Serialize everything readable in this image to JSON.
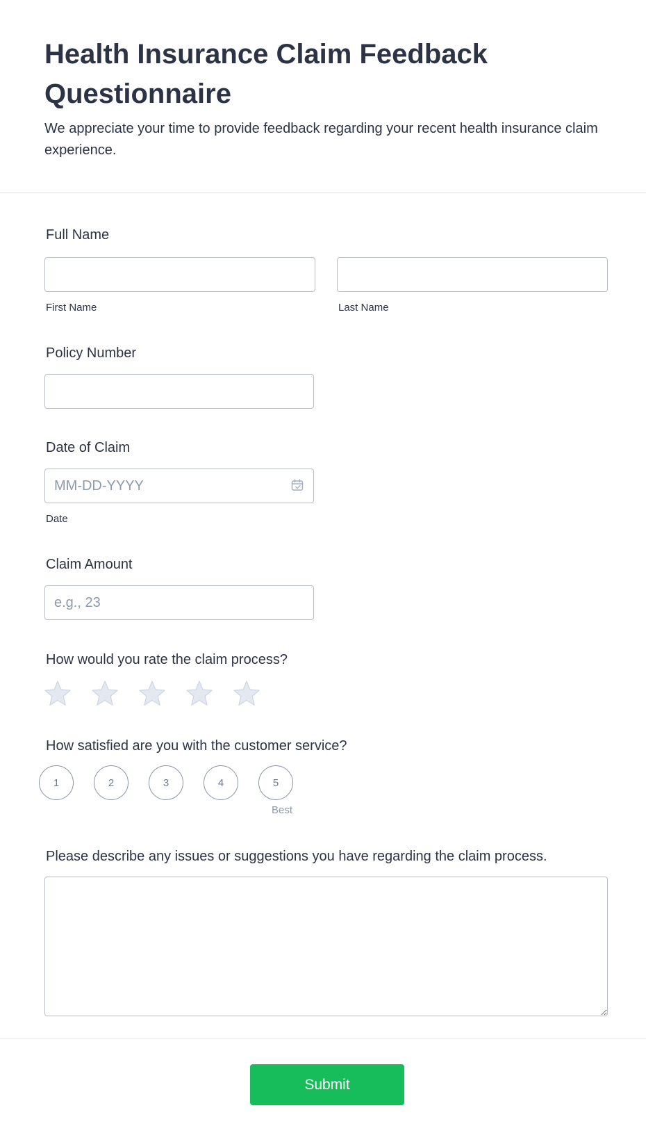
{
  "header": {
    "title": "Health Insurance Claim Feedback Questionnaire",
    "subtitle": "We appreciate your time to provide feedback regarding your recent health insurance claim experience."
  },
  "full_name": {
    "label": "Full Name",
    "first": {
      "sublabel": "First Name",
      "value": ""
    },
    "last": {
      "sublabel": "Last Name",
      "value": ""
    }
  },
  "policy_number": {
    "label": "Policy Number",
    "value": ""
  },
  "date_of_claim": {
    "label": "Date of Claim",
    "placeholder": "MM-DD-YYYY",
    "sublabel": "Date",
    "icon": "calendar-icon"
  },
  "claim_amount": {
    "label": "Claim Amount",
    "placeholder": "e.g., 23"
  },
  "rating": {
    "label": "How would you rate the claim process?",
    "max": 5,
    "value": 0,
    "icon": "star-icon",
    "empty_color": "#e3e8f1",
    "stroke_color": "#cfd5e1"
  },
  "satisfaction": {
    "label": "How satisfied are you with the customer service?",
    "options": [
      "1",
      "2",
      "3",
      "4",
      "5"
    ],
    "best_label": "Best"
  },
  "issues": {
    "label": "Please describe any issues or suggestions you have regarding the claim process.",
    "value": ""
  },
  "submit": {
    "label": "Submit",
    "color": "#18bd5b"
  }
}
